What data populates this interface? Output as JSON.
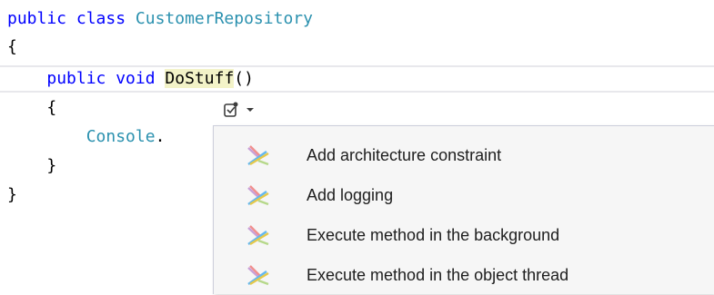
{
  "code": {
    "line1": {
      "kw": "public class",
      "name": "CustomerRepository"
    },
    "line2": "{",
    "line3": {
      "kw": "public void",
      "method": "DoStuff",
      "rest": "()"
    },
    "line4": "{",
    "line5": {
      "type": "Console",
      "dot": "."
    },
    "line6": "}",
    "line7": "}"
  },
  "smart_tag": {
    "icon": "quick-action-icon",
    "arrow": "▾"
  },
  "menu": {
    "items": [
      {
        "label": "Add architecture constraint",
        "icon": "postsharp-aspect-icon"
      },
      {
        "label": "Add logging",
        "icon": "postsharp-aspect-icon"
      },
      {
        "label": "Execute method in the background",
        "icon": "postsharp-aspect-icon"
      },
      {
        "label": "Execute method in the object thread",
        "icon": "postsharp-aspect-icon"
      }
    ]
  },
  "colors": {
    "keyword": "#0000ff",
    "type": "#2b91af",
    "highlight": "#f3f3c8",
    "menu_bg": "#f6f6f6"
  }
}
